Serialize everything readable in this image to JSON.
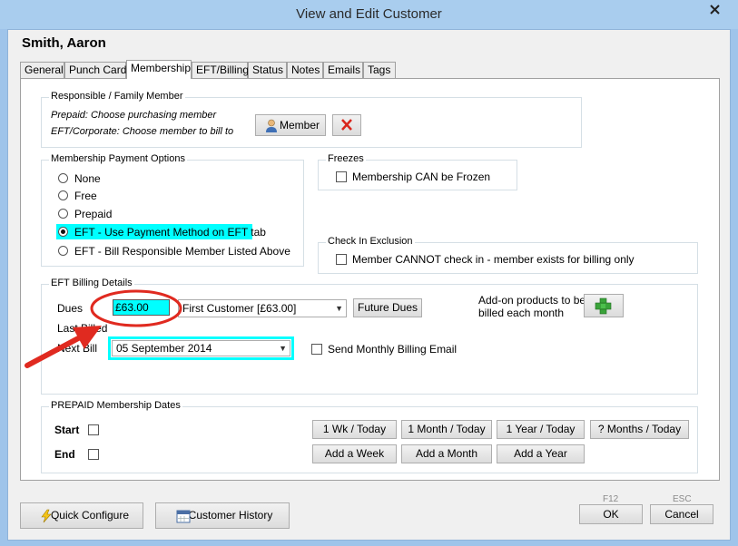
{
  "window": {
    "title": "View and Edit Customer"
  },
  "customer": {
    "name": "Smith, Aaron"
  },
  "tabs": [
    {
      "label": "General"
    },
    {
      "label": "Punch Card"
    },
    {
      "label": "Membership"
    },
    {
      "label": "EFT/Billing"
    },
    {
      "label": "Status"
    },
    {
      "label": "Notes"
    },
    {
      "label": "Emails"
    },
    {
      "label": "Tags"
    }
  ],
  "responsible": {
    "legend": "Responsible / Family Member",
    "line1": "Prepaid:  Choose purchasing member",
    "line2": "EFT/Corporate: Choose member to bill to",
    "member_button": "Member"
  },
  "payment_options": {
    "legend": "Membership Payment Options",
    "options": [
      {
        "label": "None"
      },
      {
        "label": "Free"
      },
      {
        "label": "Prepaid"
      },
      {
        "label": "EFT - Use Payment Method on EFT tab"
      },
      {
        "label": "EFT - Bill Responsible Member Listed Above"
      }
    ],
    "selected": "EFT - Use Payment Method on EFT tab"
  },
  "freezes": {
    "legend": "Freezes",
    "checkbox_label": "Membership CAN be Frozen"
  },
  "checkin_exclusion": {
    "legend": "Check In Exclusion",
    "checkbox_label": "Member CANNOT check in - member exists for billing only"
  },
  "eft_billing": {
    "legend": "EFT Billing Details",
    "dues_label": "Dues",
    "dues_value": "£63.00",
    "dues_plan": "First Customer [£63.00]",
    "future_dues_button": "Future Dues",
    "addon_label_line1": "Add-on products to be",
    "addon_label_line2": "billed each month",
    "last_billed_label": "Last Billed",
    "next_bill_label": "Next Bill",
    "next_bill_value": "05 September 2014",
    "send_email_label": "Send Monthly Billing Email"
  },
  "prepaid_dates": {
    "legend": "PREPAID Membership Dates",
    "start_label": "Start",
    "end_label": "End",
    "buttons_row1": [
      "1 Wk / Today",
      "1 Month / Today",
      "1 Year / Today",
      "? Months / Today"
    ],
    "buttons_row2": [
      "Add a Week",
      "Add a Month",
      "Add a Year"
    ]
  },
  "footer": {
    "quick_configure": "Quick Configure",
    "customer_history": "Customer History",
    "ok_key": "F12",
    "ok": "OK",
    "cancel_key": "ESC",
    "cancel": "Cancel"
  },
  "colors": {
    "highlight": "#00ffff",
    "annotation_red": "#e02a20",
    "title_bar": "#a9cdee"
  }
}
